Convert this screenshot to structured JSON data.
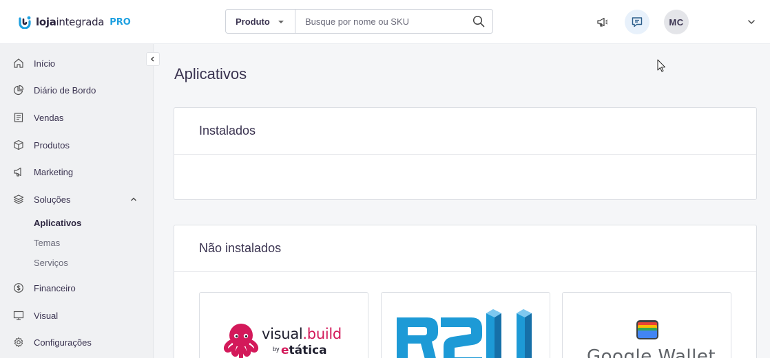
{
  "header": {
    "logo_text_bold": "loja",
    "logo_text_rest": "integrada",
    "logo_badge": "PRO",
    "search": {
      "category": "Produto",
      "placeholder": "Busque por nome ou SKU"
    },
    "avatar_initials": "MC",
    "icons": {
      "announcements": "megaphone-icon",
      "chat": "chat-icon",
      "search": "search-icon",
      "menu": "chevron-down-icon"
    }
  },
  "sidebar": {
    "items": [
      {
        "label": "Início",
        "icon": "home-icon"
      },
      {
        "label": "Diário de Bordo",
        "icon": "pie-chart-icon"
      },
      {
        "label": "Vendas",
        "icon": "receipt-icon"
      },
      {
        "label": "Produtos",
        "icon": "box-icon"
      },
      {
        "label": "Marketing",
        "icon": "megaphone-icon"
      },
      {
        "label": "Soluções",
        "icon": "layers-icon",
        "expanded": true
      },
      {
        "label": "Financeiro",
        "icon": "dollar-icon"
      },
      {
        "label": "Visual",
        "icon": "monitor-icon"
      },
      {
        "label": "Configurações",
        "icon": "gear-icon"
      }
    ],
    "sub_items": [
      {
        "label": "Aplicativos",
        "active": true
      },
      {
        "label": "Temas",
        "active": false
      },
      {
        "label": "Serviços",
        "active": false
      }
    ]
  },
  "main": {
    "title": "Aplicativos",
    "installed_title": "Instalados",
    "not_installed_title": "Não instalados",
    "apps": [
      {
        "name_part1": "visual",
        "name_part2": ".build",
        "by": "by",
        "brand_e": "e",
        "brand_rest": "tática"
      },
      {
        "name": "R2U"
      },
      {
        "name": "Google Wallet"
      }
    ]
  },
  "colors": {
    "accent": "#1ea0e0",
    "brand_pink": "#d3195a",
    "r2u_blue": "#1d9ad6",
    "text": "#3a3350"
  }
}
